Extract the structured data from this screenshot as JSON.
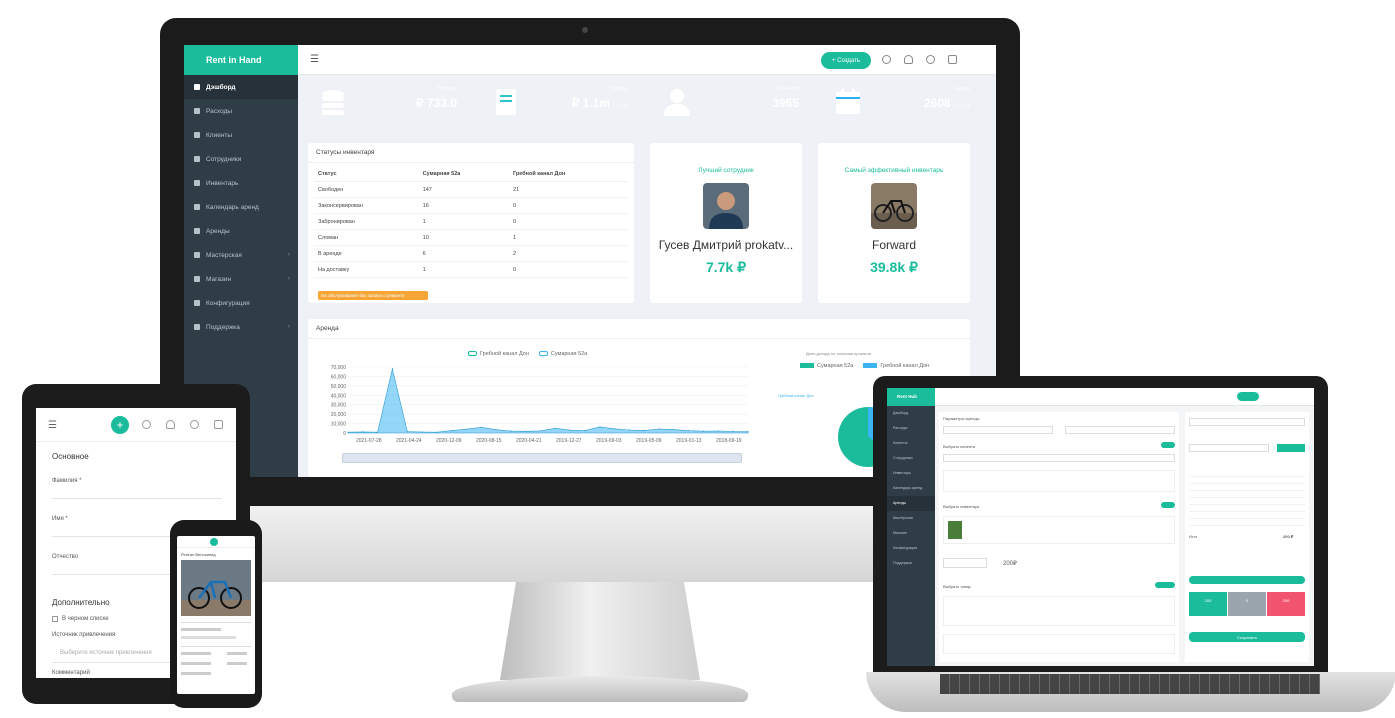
{
  "monitor": {
    "brand": "Rent in Hand",
    "sidebar": [
      {
        "label": "Дэшборд",
        "icon": "dashboard-icon",
        "active": true
      },
      {
        "label": "Расходы",
        "icon": "expenses-icon"
      },
      {
        "label": "Клиенты",
        "icon": "clients-icon"
      },
      {
        "label": "Сотрудники",
        "icon": "employees-icon"
      },
      {
        "label": "Инвентарь",
        "icon": "inventory-icon"
      },
      {
        "label": "Календарь аренд",
        "icon": "calendar-icon"
      },
      {
        "label": "Аренды",
        "icon": "rentals-icon"
      },
      {
        "label": "Мастерская",
        "icon": "workshop-icon",
        "caret": true
      },
      {
        "label": "Магазин",
        "icon": "shop-icon",
        "caret": true
      },
      {
        "label": "Конфигурация",
        "icon": "config-icon"
      },
      {
        "label": "Поддержка",
        "icon": "support-icon",
        "caret": true
      }
    ],
    "topbar": {
      "create_label": "+ Создать"
    },
    "stats": [
      {
        "label": "Расходы",
        "value": "₽ 733.0",
        "sub": "",
        "color": "#1abc9c",
        "icon": "coins-icon"
      },
      {
        "label": "Доходы",
        "value": "₽ 1.1m",
        "sub": "/ 2.5k",
        "color": "#2ec4cc",
        "icon": "book-icon"
      },
      {
        "label": "Клиентов",
        "value": "3965",
        "sub": "",
        "color": "#f9a13a",
        "icon": "user-icon"
      },
      {
        "label": "Аренд",
        "value": "2608",
        "sub": "/ 2.0 к",
        "color": "#2ab0ef",
        "icon": "calendar-icon"
      }
    ],
    "inventory": {
      "title": "Статусы инвентаря",
      "headers": [
        "Статус",
        "Сумарная 52а",
        "Гребной канал Дон"
      ],
      "rows": [
        [
          "Свободен",
          "147",
          "21"
        ],
        [
          "Законсервирован",
          "16",
          "0"
        ],
        [
          "Забронирован",
          "1",
          "0"
        ],
        [
          "Сломан",
          "10",
          "1"
        ],
        [
          "В аренде",
          "6",
          "2"
        ],
        [
          "На доставку",
          "1",
          "0"
        ]
      ],
      "warning": "На обслуживание без записи о ремонте"
    },
    "best_employee": {
      "title": "Лучший сотрудник",
      "name": "Гусев Дмитрий prokatv...",
      "value": "7.7k ₽"
    },
    "best_inventory": {
      "title": "Самый эффективный инвентарь",
      "name": "Forward",
      "value": "39.8k ₽"
    },
    "rent_chart": {
      "title": "Аренда",
      "legend": [
        "Гребной канал Дон",
        "Сумарная 52а"
      ],
      "pie_title": "Доля дохода по точечная прокатов",
      "pie_legend": [
        "Сумарная 52а",
        "Гребной канал Дон"
      ],
      "pie_label": "Гребной канал Дон",
      "colors": {
        "a": "#1abc9c",
        "b": "#3ab4f2"
      }
    }
  },
  "chart_data": {
    "type": "area",
    "title": "Аренда",
    "y_ticks": [
      "70,000",
      "60,000",
      "50,000",
      "40,000",
      "30,000",
      "20,000",
      "10,000",
      "0"
    ],
    "x_ticks": [
      "2021-07-28",
      "2021-04-24",
      "2020-12-09",
      "2020-08-15",
      "2020-04-21",
      "2019-12-27",
      "2019-09-03",
      "2019-05-09",
      "2019-01-13",
      "2018-09-19"
    ],
    "ylim": [
      0,
      70000
    ],
    "series": [
      {
        "name": "Гребной канал Дон",
        "values": [
          800,
          1200,
          900,
          68000,
          1500,
          1100,
          900,
          2500,
          4000,
          6000,
          3500,
          2000,
          1800,
          2200,
          5000,
          3000,
          2500,
          6500,
          4500,
          3200,
          2800,
          4200,
          3600,
          2400,
          1900,
          2100,
          1600,
          1400
        ]
      }
    ]
  },
  "tablet": {
    "section1": "Основное",
    "fields": [
      "Фамилия *",
      "Имя *",
      "Отчество"
    ],
    "section2": "Дополнительно",
    "checkbox": "В черном списке",
    "source_label": "Источник привлечения",
    "source_placeholder": "Выберите источник привлечения",
    "last_label": "Комментарий"
  },
  "phone": {
    "title": "Рентал Велосипед"
  },
  "laptop": {
    "brand": "Rent Hub",
    "sidebar": [
      "Дэшборд",
      "Расходы",
      "Клиенты",
      "Сотрудники",
      "Инвентарь",
      "Календарь аренд",
      "Аренды",
      "Мастерская",
      "Магазин",
      "Конфигурация",
      "Поддержка"
    ],
    "rental_title": "Параметры аренды",
    "client_section": "Выбрать клиента",
    "inventory_section": "Выбрать инвентарь",
    "sale_section": "Выбрать товар",
    "price": "200₽",
    "total_label": "Итог",
    "total": "200 ₽",
    "boxes": [
      "200",
      "0",
      "200"
    ],
    "save_label": "Сохранить"
  }
}
